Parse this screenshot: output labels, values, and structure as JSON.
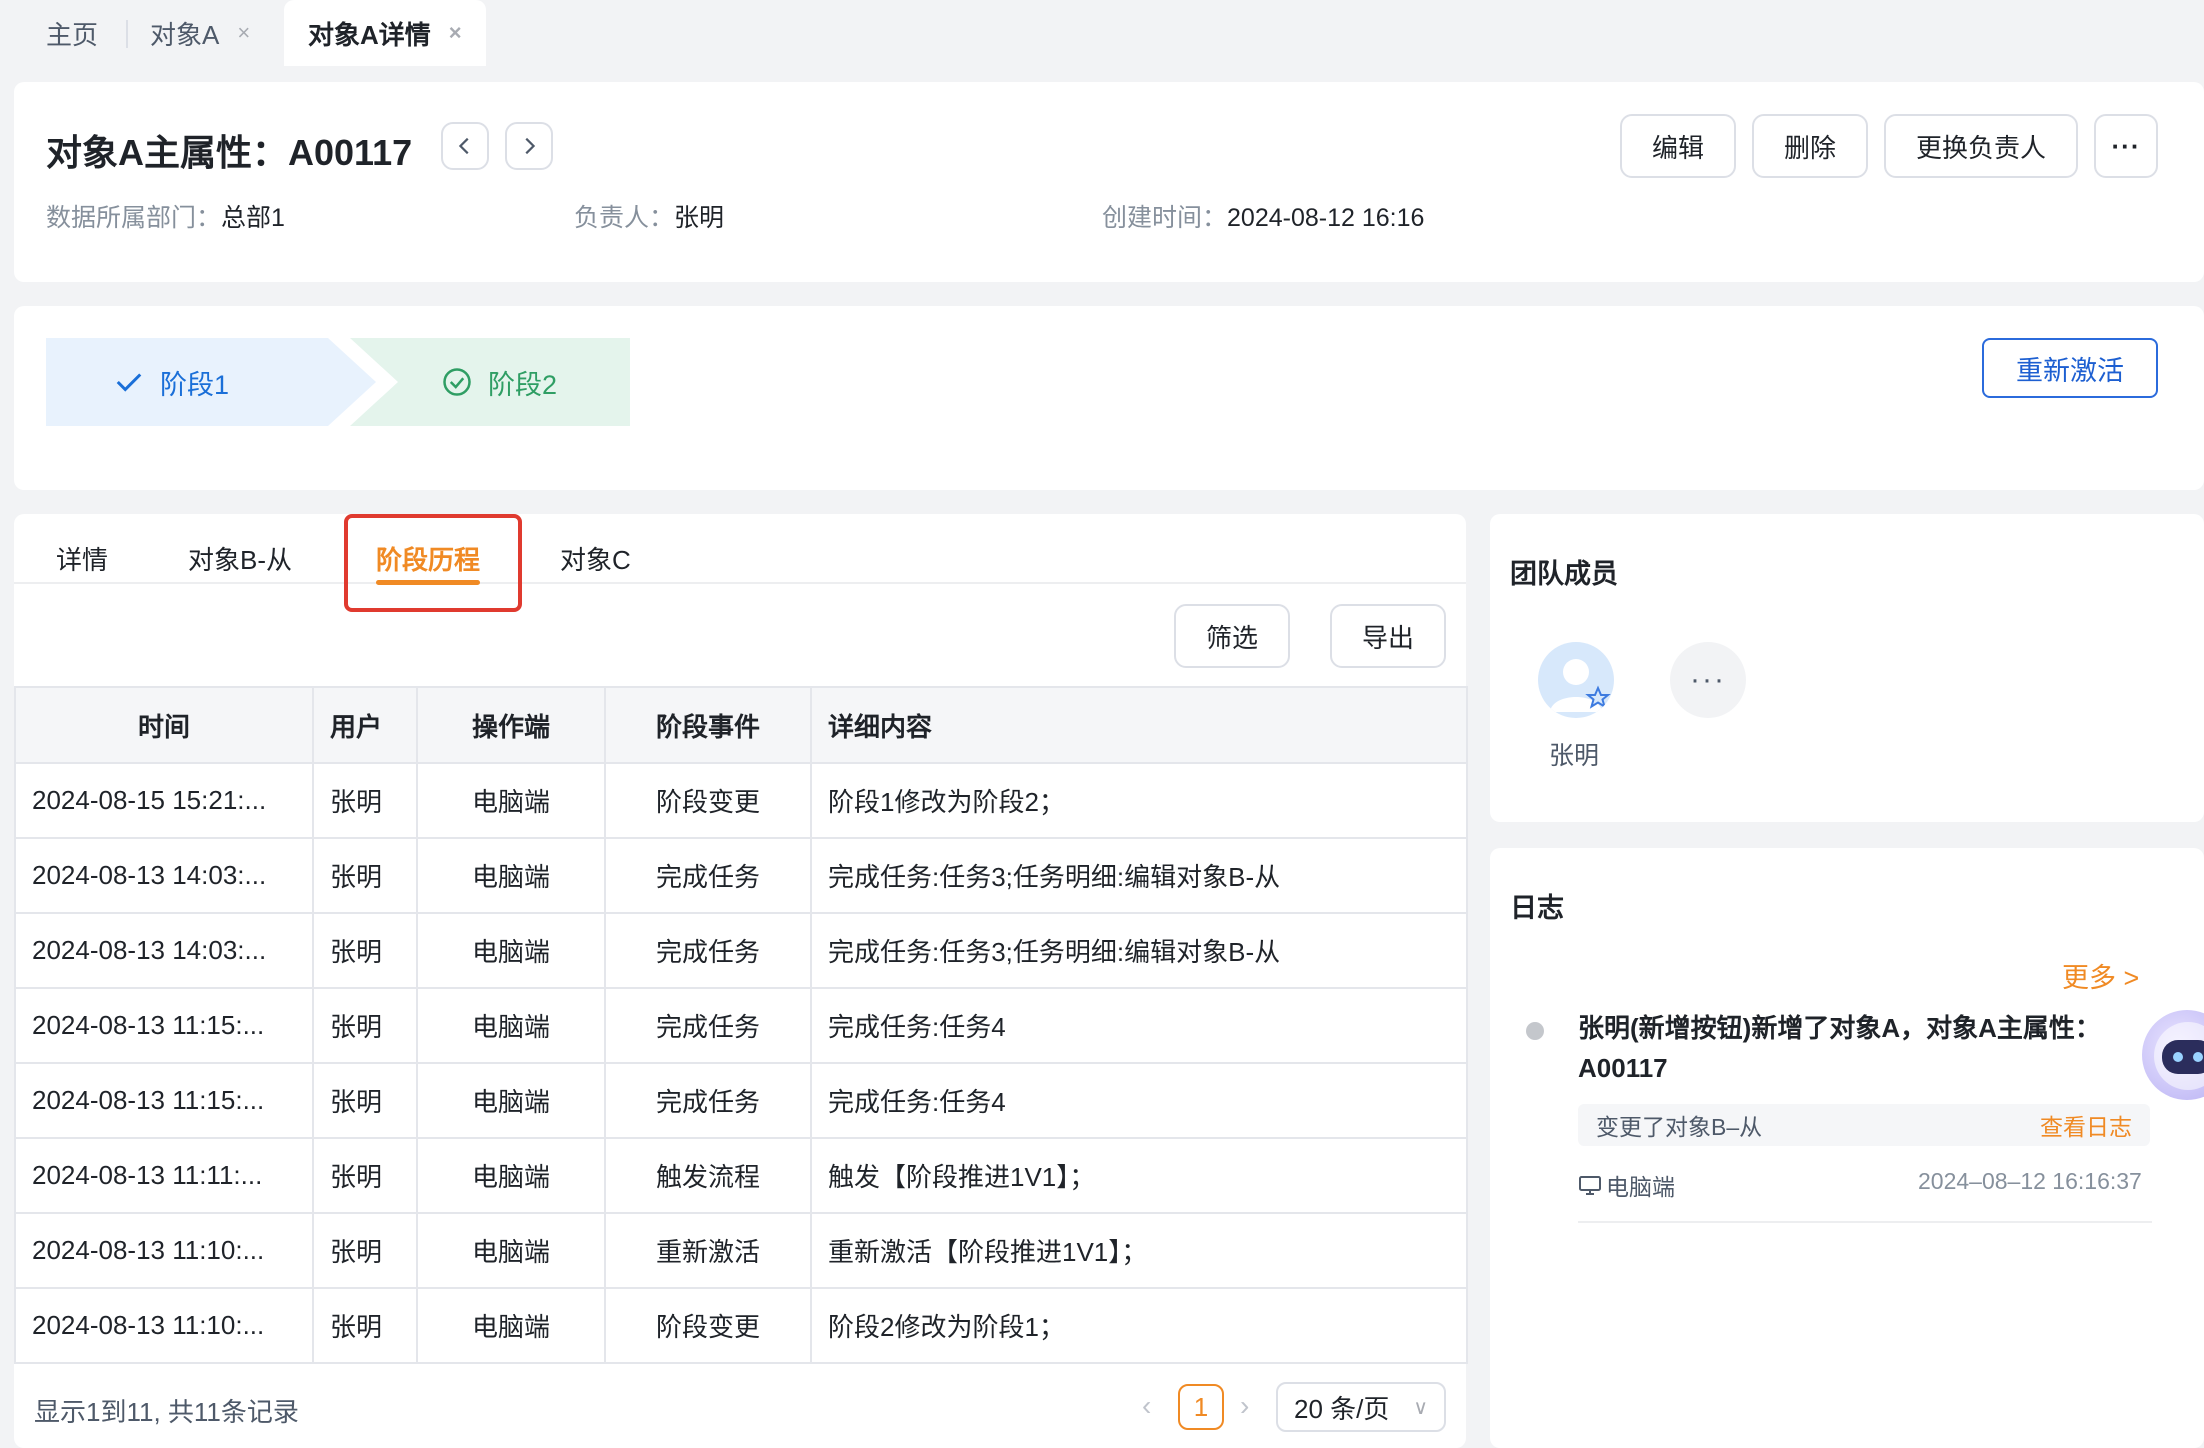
{
  "top_tabs": [
    {
      "label": "主页"
    },
    {
      "label": "对象A",
      "close": "×"
    },
    {
      "label": "对象A详情",
      "close": "×"
    }
  ],
  "header": {
    "title": "对象A主属性：A00117",
    "buttons": {
      "edit": "编辑",
      "delete": "删除",
      "change_owner": "更换负责人",
      "more": "···"
    },
    "meta": [
      {
        "key": "数据所属部门：",
        "value": "总部1"
      },
      {
        "key": "负责人：",
        "value": "张明"
      },
      {
        "key": "创建时间：",
        "value": "2024-08-12 16:16"
      }
    ]
  },
  "stages": [
    {
      "label": "阶段1",
      "icon": "check-icon",
      "color": "#1a6fd8"
    },
    {
      "label": "阶段2",
      "icon": "check-circle-icon",
      "color": "#2f9e64"
    }
  ],
  "reactivate_label": "重新激活",
  "detail_tabs": [
    "详情",
    "对象B-从",
    "阶段历程",
    "对象C"
  ],
  "active_tab_index": 2,
  "toolbar": {
    "filter": "筛选",
    "export": "导出"
  },
  "table": {
    "columns": [
      "时间",
      "用户",
      "操作端",
      "阶段事件",
      "详细内容"
    ],
    "rows": [
      [
        "2024-08-15 15:21:...",
        "张明",
        "电脑端",
        "阶段变更",
        "阶段1修改为阶段2；"
      ],
      [
        "2024-08-13 14:03:...",
        "张明",
        "电脑端",
        "完成任务",
        "完成任务:任务3;任务明细:编辑对象B-从"
      ],
      [
        "2024-08-13 14:03:...",
        "张明",
        "电脑端",
        "完成任务",
        "完成任务:任务3;任务明细:编辑对象B-从"
      ],
      [
        "2024-08-13 11:15:...",
        "张明",
        "电脑端",
        "完成任务",
        "完成任务:任务4"
      ],
      [
        "2024-08-13 11:15:...",
        "张明",
        "电脑端",
        "完成任务",
        "完成任务:任务4"
      ],
      [
        "2024-08-13 11:11:...",
        "张明",
        "电脑端",
        "触发流程",
        "触发【阶段推进1V1】；"
      ],
      [
        "2024-08-13 11:10:...",
        "张明",
        "电脑端",
        "重新激活",
        "重新激活【阶段推进1V1】；"
      ],
      [
        "2024-08-13 11:10:...",
        "张明",
        "电脑端",
        "阶段变更",
        "阶段2修改为阶段1；"
      ]
    ]
  },
  "pagination": {
    "summary": "显示1到11, 共11条记录",
    "current_page": "1",
    "page_size": "20 条/页"
  },
  "team": {
    "title": "团队成员",
    "members": [
      {
        "name": "张明"
      }
    ],
    "more": "···"
  },
  "log": {
    "title": "日志",
    "more_link": "更多 >",
    "entries": [
      {
        "text": "张明(新增按钮)新增了对象A，对象A主属性：A00117",
        "detail": "变更了对象B–从",
        "view_link": "查看日志",
        "device": "电脑端",
        "time": "2024–08–12 16:16:37"
      }
    ]
  },
  "colors": {
    "accent": "#f08a24",
    "primary": "#2b6bdc",
    "highlight": "#e03a2f"
  }
}
